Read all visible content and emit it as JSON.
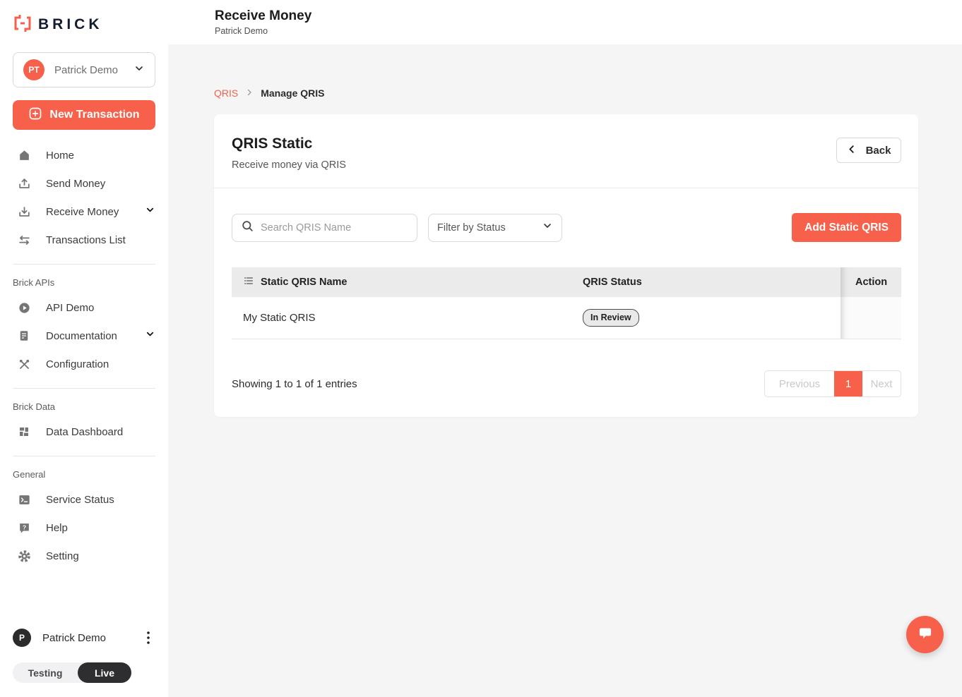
{
  "brand": {
    "name": "BRICK"
  },
  "header": {
    "title": "Receive Money",
    "subtitle": "Patrick Demo"
  },
  "sidebar": {
    "account": {
      "initials": "PT",
      "name": "Patrick Demo"
    },
    "new_transaction_label": "New Transaction",
    "nav": [
      {
        "label": "Home",
        "icon": "home-icon"
      },
      {
        "label": "Send Money",
        "icon": "send-money-icon"
      },
      {
        "label": "Receive Money",
        "icon": "receive-money-icon",
        "expandable": true
      },
      {
        "label": "Transactions List",
        "icon": "transactions-icon"
      }
    ],
    "sections": [
      {
        "title": "Brick APIs",
        "items": [
          {
            "label": "API Demo",
            "icon": "play-circle-icon"
          },
          {
            "label": "Documentation",
            "icon": "document-icon",
            "expandable": true
          },
          {
            "label": "Configuration",
            "icon": "tools-icon"
          }
        ]
      },
      {
        "title": "Brick Data",
        "items": [
          {
            "label": "Data Dashboard",
            "icon": "dashboard-icon"
          }
        ]
      },
      {
        "title": "General",
        "items": [
          {
            "label": "Service Status",
            "icon": "terminal-icon"
          },
          {
            "label": "Help",
            "icon": "help-bubble-icon"
          },
          {
            "label": "Setting",
            "icon": "gear-icon"
          }
        ]
      }
    ],
    "footer": {
      "initials": "P",
      "name": "Patrick Demo",
      "env_toggle": {
        "testing_label": "Testing",
        "live_label": "Live",
        "active": "Live"
      }
    }
  },
  "breadcrumb": {
    "items": [
      "QRIS",
      "Manage QRIS"
    ]
  },
  "card": {
    "title": "QRIS Static",
    "subtitle": "Receive money via QRIS",
    "back_label": "Back",
    "toolbar": {
      "search_placeholder": "Search QRIS Name",
      "search_value": "",
      "filter_label": "Filter by Status",
      "add_label": "Add Static QRIS"
    },
    "table": {
      "columns": [
        "Static QRIS Name",
        "QRIS Status",
        "Action"
      ],
      "rows": [
        {
          "name": "My Static QRIS",
          "status": "In Review"
        }
      ]
    },
    "footer": {
      "summary": "Showing 1 to 1 of 1 entries",
      "pagination": {
        "previous": "Previous",
        "current": "1",
        "next": "Next"
      }
    }
  },
  "colors": {
    "accent": "#f7614b",
    "logo_text": "#151c30",
    "table_header_bg": "#ebebeb",
    "env_live_bg": "#2e2e30",
    "content_bg": "#f5f5f6"
  }
}
